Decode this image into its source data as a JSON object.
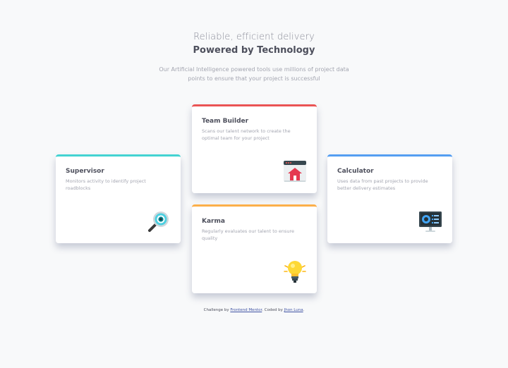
{
  "header": {
    "tagline": "Reliable, efficient delivery",
    "title": "Powered by Technology",
    "intro": "Our Artificial Intelligence powered tools use millions of project data points to ensure that your project is successful"
  },
  "cards": [
    {
      "title": "Supervisor",
      "description": "Monitors activity to identify project roadblocks",
      "icon": "magnifier-icon",
      "accent": "#44d3d2"
    },
    {
      "title": "Team Builder",
      "description": "Scans our talent network to create the optimal team for your project",
      "icon": "team-builder-icon",
      "accent": "#ea5454"
    },
    {
      "title": "Karma",
      "description": "Regularly evaluates our talent to ensure quality",
      "icon": "lightbulb-icon",
      "accent": "#fcaf4a"
    },
    {
      "title": "Calculator",
      "description": "Uses data from past projects to provide better delivery estimates",
      "icon": "calculator-monitor-icon",
      "accent": "#549ef2"
    }
  ],
  "attribution": {
    "prefix": "Challenge by",
    "link1": "Frontend Mentor",
    "middle": ". Coded by",
    "link2": "Jhon Luna",
    "suffix": "."
  },
  "colors": {
    "background": "#f8f9fa",
    "text_dark": "#4d4f5c",
    "text_light": "#a3a5b0",
    "cyan": "#44d3d2",
    "red": "#ea5454",
    "orange": "#fcaf4a",
    "blue": "#549ef2"
  }
}
